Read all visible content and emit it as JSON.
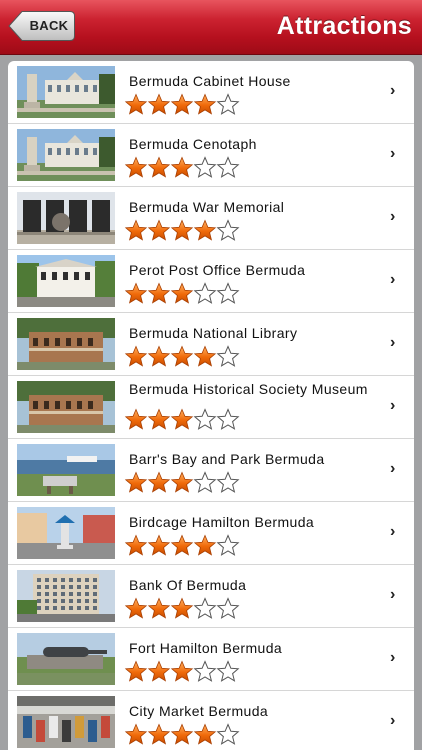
{
  "nav": {
    "back_label": "BACK",
    "title": "Attractions"
  },
  "colors": {
    "navbar": "#b5101e",
    "star_fill": "#f06a0a",
    "star_empty": "#ffffff"
  },
  "icons": {
    "row_chevron": "chevron-right-icon"
  },
  "items": [
    {
      "name": "Bermuda Cabinet House",
      "rating": 4,
      "thumb": "cabinet"
    },
    {
      "name": "Bermuda Cenotaph",
      "rating": 3,
      "thumb": "cenotaph"
    },
    {
      "name": "Bermuda War Memorial",
      "rating": 4,
      "thumb": "memorial"
    },
    {
      "name": "Perot Post Office Bermuda",
      "rating": 3,
      "thumb": "postoffice"
    },
    {
      "name": "Bermuda National Library",
      "rating": 4,
      "thumb": "library"
    },
    {
      "name": "Bermuda Historical Society Museum",
      "rating": 3,
      "thumb": "museum"
    },
    {
      "name": "Barr's Bay and Park Bermuda",
      "rating": 3,
      "thumb": "bay"
    },
    {
      "name": "Birdcage Hamilton Bermuda",
      "rating": 4,
      "thumb": "birdcage"
    },
    {
      "name": "Bank Of Bermuda",
      "rating": 3,
      "thumb": "bank"
    },
    {
      "name": "Fort Hamilton Bermuda",
      "rating": 3,
      "thumb": "fort"
    },
    {
      "name": "City Market Bermuda",
      "rating": 4,
      "thumb": "market"
    }
  ]
}
